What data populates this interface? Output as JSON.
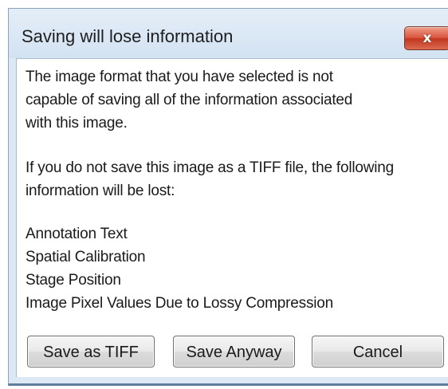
{
  "dialog": {
    "title": "Saving will lose information",
    "close_icon": "close-icon",
    "close_glyph": "x"
  },
  "body": {
    "intro_lines": [
      "The image format that you have selected is not",
      "capable of saving all of the information associated",
      "with this image."
    ],
    "warning_lines": [
      "If you do not save this image as a TIFF file, the following",
      "information will be lost:"
    ],
    "lost_items": [
      "Annotation Text",
      "Spatial Calibration",
      "Stage Position",
      "Image Pixel Values Due to Lossy Compression"
    ]
  },
  "buttons": {
    "save_tiff": "Save as TIFF",
    "save_anyway": "Save Anyway",
    "cancel": "Cancel"
  },
  "colors": {
    "titlebar": "#dce8f4",
    "close_button": "#c9432b",
    "body": "#ffffff"
  }
}
